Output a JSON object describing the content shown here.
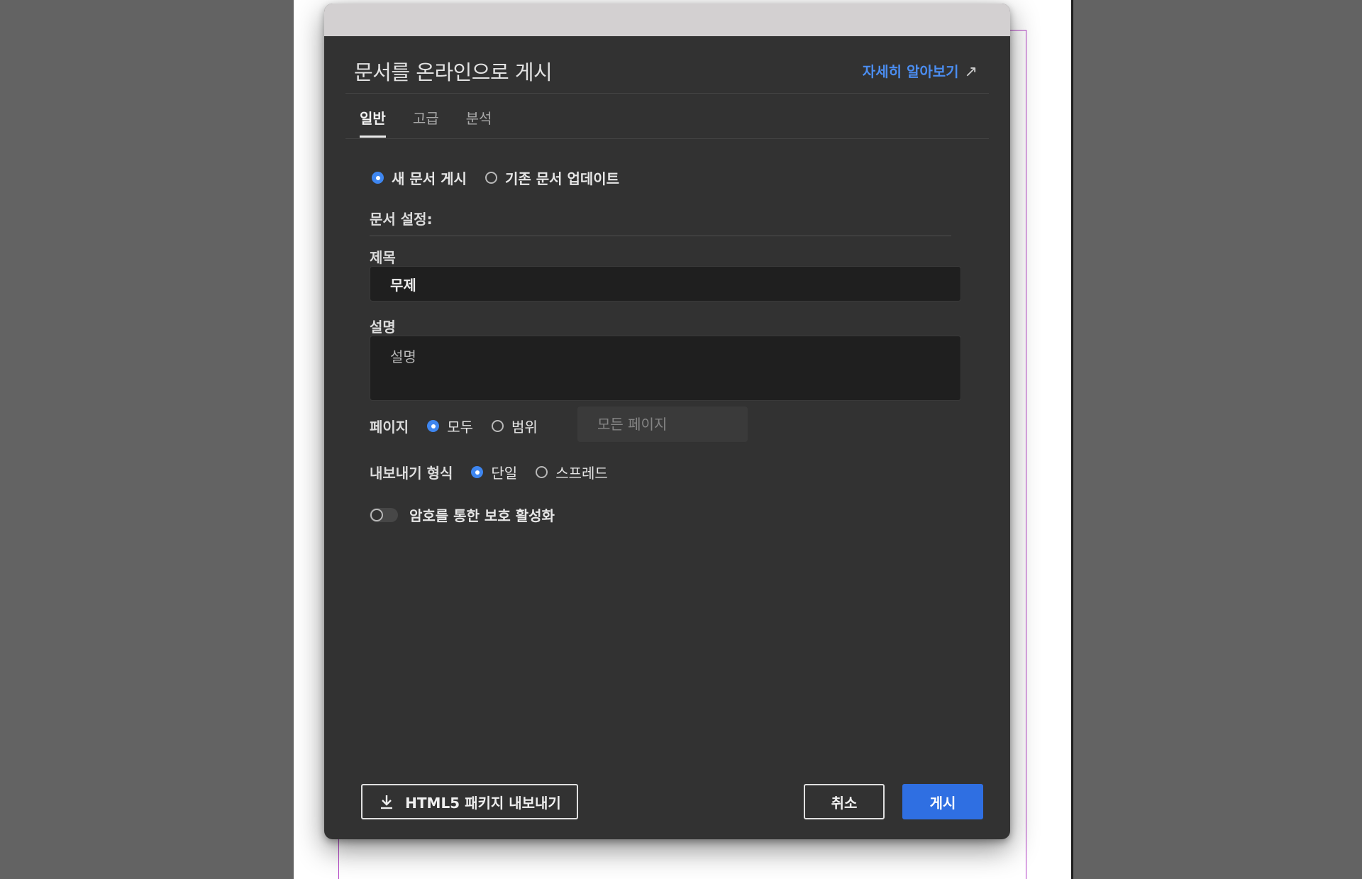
{
  "dialog": {
    "title": "문서를 온라인으로 게시",
    "learn_more": "자세히 알아보기",
    "learn_more_icon": "external-link-arrow-icon"
  },
  "tabs": [
    {
      "label": "일반",
      "active": true
    },
    {
      "label": "고급",
      "active": false
    },
    {
      "label": "분석",
      "active": false
    }
  ],
  "publish_mode": {
    "options": [
      {
        "label": "새 문서 게시",
        "selected": true
      },
      {
        "label": "기존 문서 업데이트",
        "selected": false
      }
    ]
  },
  "settings": {
    "section_label": "문서 설정:",
    "title_label": "제목",
    "title_value": "무제",
    "description_label": "설명",
    "description_placeholder": "설명"
  },
  "pages": {
    "label": "페이지",
    "options": [
      {
        "label": "모두",
        "selected": true
      },
      {
        "label": "범위",
        "selected": false
      }
    ],
    "range_placeholder": "모든 페이지"
  },
  "export_format": {
    "label": "내보내기 형식",
    "options": [
      {
        "label": "단일",
        "selected": true
      },
      {
        "label": "스프레드",
        "selected": false
      }
    ]
  },
  "password": {
    "label": "암호를 통한 보호 활성화",
    "enabled": false
  },
  "footer": {
    "export_label": "HTML5 패키지 내보내기",
    "export_icon": "download-icon",
    "cancel_label": "취소",
    "publish_label": "게시"
  },
  "colors": {
    "accent": "#2f6fe2",
    "link": "#4b8df0",
    "dialog_bg": "#323232"
  }
}
